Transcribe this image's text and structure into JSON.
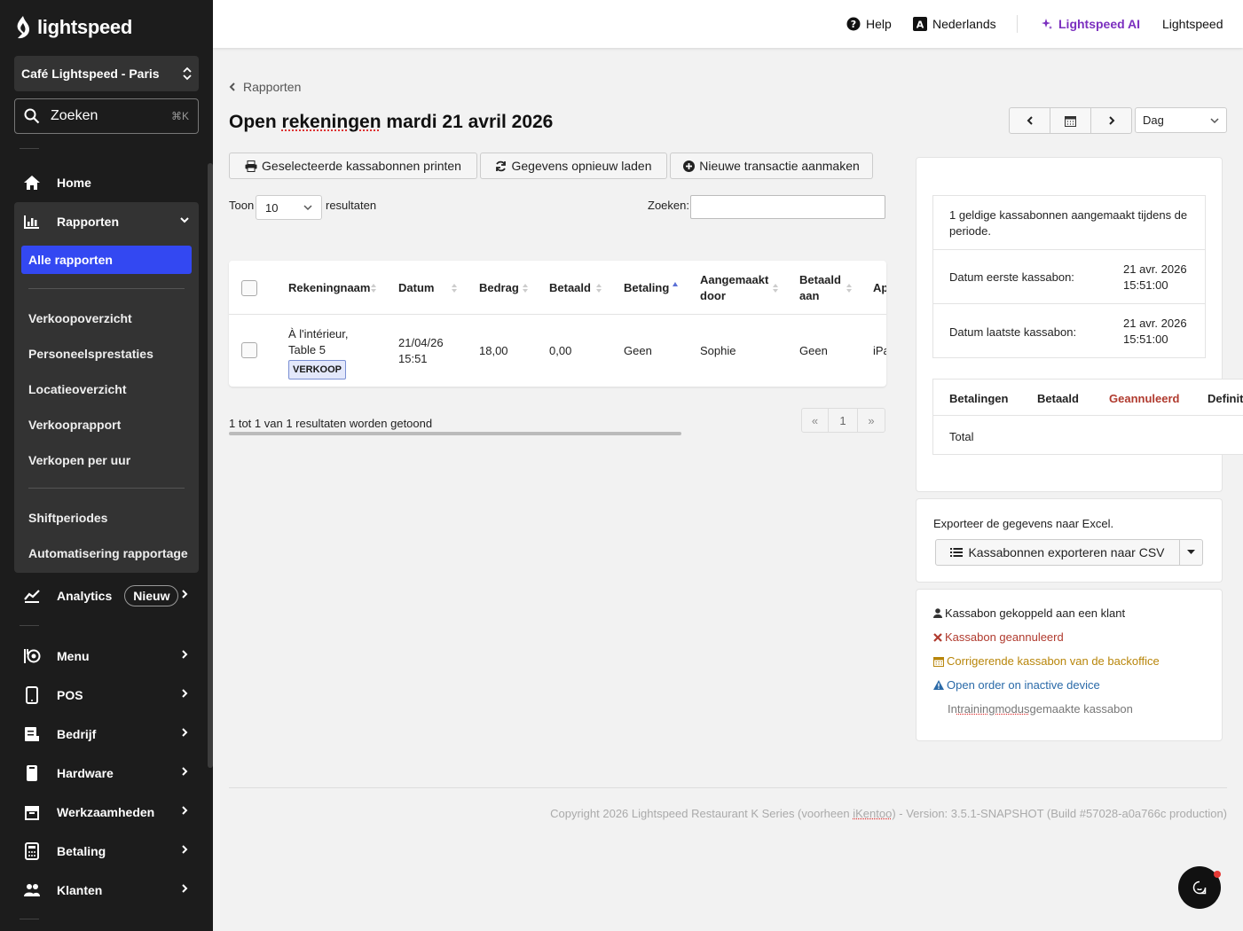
{
  "sidebar": {
    "brand": "lightspeed",
    "location": "Café Lightspeed - Paris",
    "search_label": "Zoeken",
    "search_shortcut": "⌘K",
    "nav": {
      "home": "Home",
      "rapporten": "Rapporten",
      "analytics": "Analytics",
      "analytics_badge": "Nieuw",
      "menu": "Menu",
      "pos": "POS",
      "bedrijf": "Bedrijf",
      "hardware": "Hardware",
      "werkzaamheden": "Werkzaamheden",
      "betaling": "Betaling",
      "klanten": "Klanten"
    },
    "rapporten_sub": {
      "active": "Alle rapporten",
      "items": [
        "Verkoopoverzicht",
        "Personeelsprestaties",
        "Locatieoverzicht",
        "Verkooprapport",
        "Verkopen per uur"
      ],
      "items2": [
        "Shiftperiodes",
        "Automatisering rapportage"
      ]
    }
  },
  "topbar": {
    "help": "Help",
    "language": "Nederlands",
    "ai": "Lightspeed AI",
    "account": "Lightspeed"
  },
  "main": {
    "breadcrumb": "Rapporten",
    "title_prefix": "Open ",
    "title_word": "rekeningen",
    "title_suffix": " mardi 21 avril 2026",
    "period_select": "Dag",
    "buttons": {
      "print": "Geselecteerde kassabonnen printen",
      "reload": "Gegevens opnieuw laden",
      "new": "Nieuwe transactie aanmaken"
    },
    "show_label": "Toon",
    "show_value": "10",
    "results_label": "resultaten",
    "search_label": "Zoeken:",
    "table": {
      "headers": [
        "Rekeningnaam",
        "Datum",
        "Bedrag",
        "Betaald",
        "Betaling",
        "Aangemaakt door",
        "Betaald aan",
        "Ap"
      ],
      "rows": [
        {
          "name_line1": "À l'intérieur,",
          "name_line2": "Table 5",
          "tag": "VERKOOP",
          "date_line1": "21/04/26",
          "date_line2": "15:51",
          "amount": "18,00",
          "paid": "0,00",
          "payment": "Geen",
          "created_by": "Sophie",
          "paid_to": "Geen",
          "app": "iPa"
        }
      ]
    },
    "info": "1 tot 1 van 1 resultaten worden getoond",
    "pager": {
      "prev": "«",
      "page": "1",
      "next": "»"
    }
  },
  "summary": {
    "valid_text": "1 geldige kassabonnen aangemaakt tijdens de periode.",
    "first_label": "Datum eerste kassabon:",
    "first_value_1": "21 avr. 2026",
    "first_value_2": "15:51:00",
    "last_label": "Datum laatste kassabon:",
    "last_value_1": "21 avr. 2026",
    "last_value_2": "15:51:00",
    "payments_tabs": [
      "Betalingen",
      "Betaald",
      "Geannuleerd",
      "Definit"
    ],
    "total_label": "Total"
  },
  "export": {
    "label": "Exporteer de gegevens naar Excel.",
    "button": "Kassabonnen exporteren naar CSV"
  },
  "legend": {
    "customer": "Kassabon gekoppeld aan een klant",
    "cancelled": "Kassabon geannuleerd",
    "corrective": "Corrigerende kassabon van de backoffice",
    "inactive": "Open order on inactive device",
    "training_prefix": "In ",
    "training_word": "trainingmodus",
    "training_suffix": " gemaakte kassabon"
  },
  "footer": {
    "text_prefix": "Copyright 2026 Lightspeed Restaurant K Series (voorheen ",
    "text_word": "iKentoo",
    "text_suffix": ") - Version: 3.5.1-SNAPSHOT (Build #57028-a0a766c production)"
  },
  "colors": {
    "accent": "#3348f2",
    "ai": "#7b2fbf",
    "cancelled": "#b03a2e",
    "corrective": "#b8860b",
    "inactive": "#2a6aa8"
  }
}
